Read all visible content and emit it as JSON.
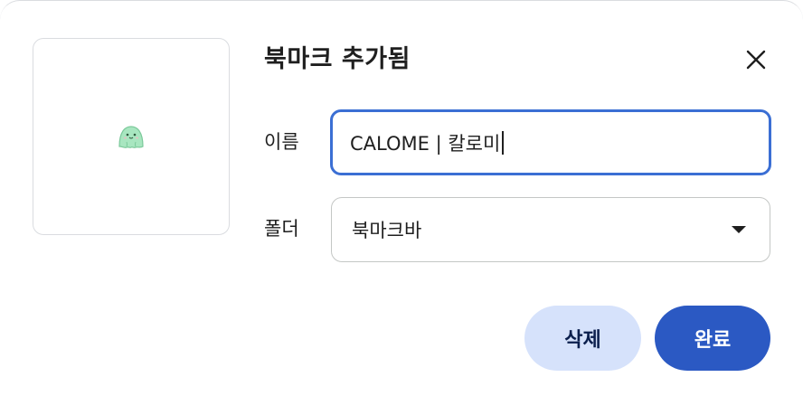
{
  "dialog": {
    "title": "북마크 추가됨",
    "close_icon": "close-icon",
    "favicon_icon": "calome-mascot-icon"
  },
  "form": {
    "name_label": "이름",
    "name_value": "CALOME | 칼로미",
    "folder_label": "폴더",
    "folder_value": "북마크바",
    "folder_icon": "chevron-down-icon"
  },
  "actions": {
    "delete_label": "삭제",
    "done_label": "완료"
  },
  "colors": {
    "primary": "#2b59c3",
    "secondary_bg": "#d6e2fb",
    "focus_border": "#3b6fd4",
    "mascot": "#a8e6c0"
  }
}
